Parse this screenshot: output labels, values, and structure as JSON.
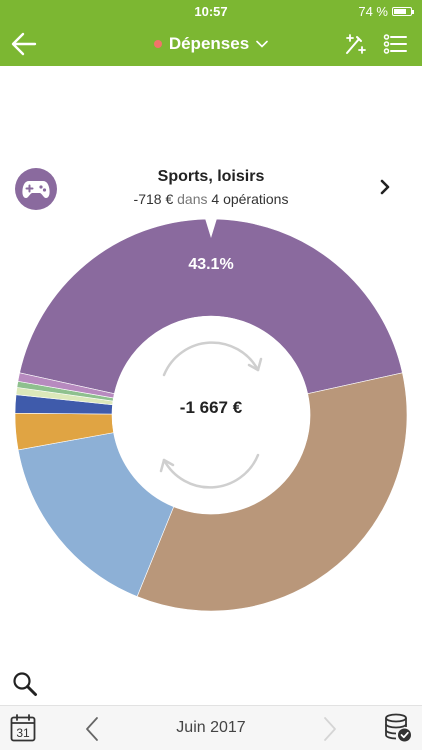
{
  "status_bar": {
    "time": "10:57",
    "battery": "74 %",
    "battery_level": 0.74
  },
  "nav": {
    "back_icon": "arrow-left-icon",
    "title": "Dépenses",
    "title_dot_color": "#f2736a",
    "dropdown_icon": "chevron-down-icon",
    "split_icon": "wand-plus-icon",
    "list_icon": "list-icon",
    "bar_color": "#7cb732"
  },
  "category": {
    "icon": "gamepad-icon",
    "badge_color": "#8a6a9e",
    "name": "Sports, loisirs",
    "amount": "-718 €",
    "connector": "dans",
    "count": "4",
    "operations_label": "opérations",
    "next_icon": "chevron-right-icon"
  },
  "center": {
    "total": "-1 667 €",
    "refresh_icon": "refresh-icon"
  },
  "chart_data": {
    "type": "pie",
    "variant": "donut",
    "selected_label": "43.1%",
    "total": "-1 667 €",
    "slices": [
      {
        "color": "#8a6a9e",
        "fraction": 0.431
      },
      {
        "color": "#b9977a",
        "fraction": 0.346
      },
      {
        "color": "#8db0d6",
        "fraction": 0.16
      },
      {
        "color": "#e0a443",
        "fraction": 0.03
      },
      {
        "color": "#3f5bab",
        "fraction": 0.015
      },
      {
        "color": "#dce8ba",
        "fraction": 0.006
      },
      {
        "color": "#8ec08e",
        "fraction": 0.005
      },
      {
        "color": "#b78abf",
        "fraction": 0.007
      }
    ]
  },
  "toolbar": {
    "search_icon": "search-icon",
    "calendar_icon": "calendar-icon",
    "calendar_day": "31",
    "prev_icon": "chevron-left-icon",
    "period": "Juin 2017",
    "next_icon": "chevron-right-icon",
    "database_icon": "database-check-icon"
  }
}
